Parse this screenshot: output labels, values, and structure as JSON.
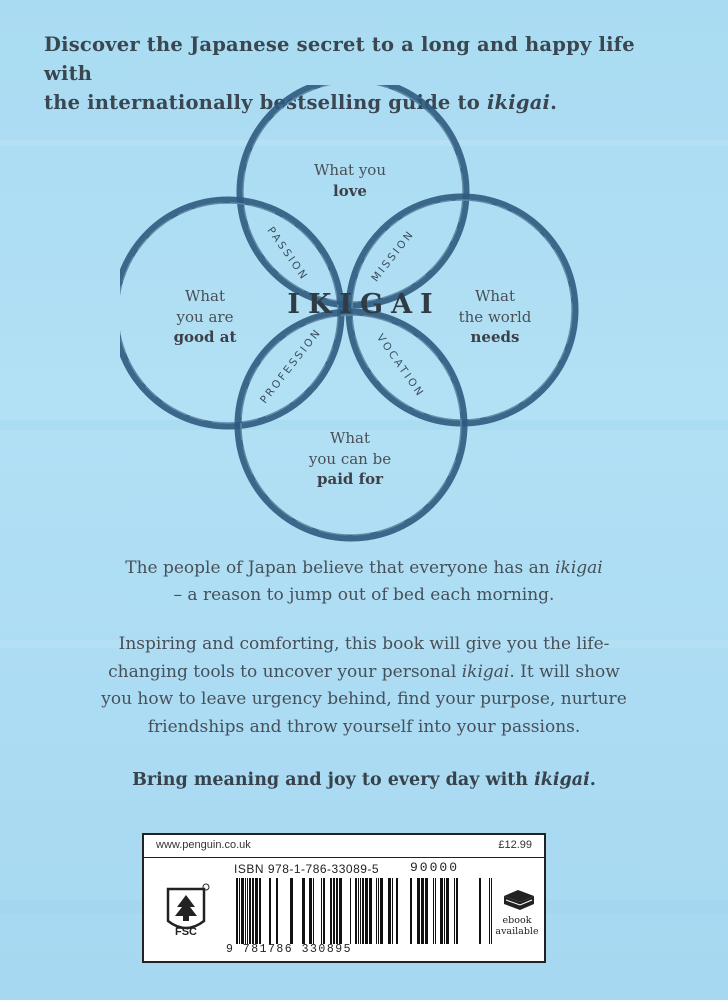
{
  "headline": {
    "line1": "Discover the Japanese secret to a long and happy life with",
    "line2_prefix": "the internationally bestselling guide to ",
    "line2_italic": "ikigai",
    "line2_suffix": "."
  },
  "diagram": {
    "center_title": "IKIGAI",
    "circles": {
      "top": {
        "line1": "What you",
        "bold": "love"
      },
      "left": {
        "line1": "What",
        "line2": "you are",
        "bold": "good at"
      },
      "right": {
        "line1": "What",
        "line2": "the world",
        "bold": "needs"
      },
      "bottom": {
        "line1": "What",
        "line2": "you can be",
        "bold": "paid for"
      }
    },
    "overlaps": {
      "passion": "PASSION",
      "mission": "MISSION",
      "profession": "PROFESSION",
      "vocation": "VOCATION"
    },
    "ring_color": "#2e5a7e"
  },
  "para1": {
    "line1_prefix": "The people of Japan believe that everyone has an ",
    "line1_italic": "ikigai",
    "line2": "– a reason to jump out of bed each morning."
  },
  "para2": {
    "line1": "Inspiring and comforting, this book will give you the life-",
    "line2_prefix": "changing tools to uncover your personal ",
    "line2_italic": "ikigai",
    "line2_suffix": ". It will show",
    "line3": "you how to leave urgency behind, find your purpose, nurture",
    "line4": "friendships and throw yourself into your passions."
  },
  "closing": {
    "prefix": "Bring meaning and joy to every day with ",
    "italic": "ikigai",
    "suffix": "."
  },
  "barcode_box": {
    "url": "www.penguin.co.uk",
    "price": "£12.99",
    "isbn": "ISBN  978-1-786-33089-5",
    "fsc_label": "FSC",
    "barcode_digits": "9 781786 330895",
    "addon_digits": "90000",
    "ebook_line1": "ebook",
    "ebook_line2": "available"
  }
}
